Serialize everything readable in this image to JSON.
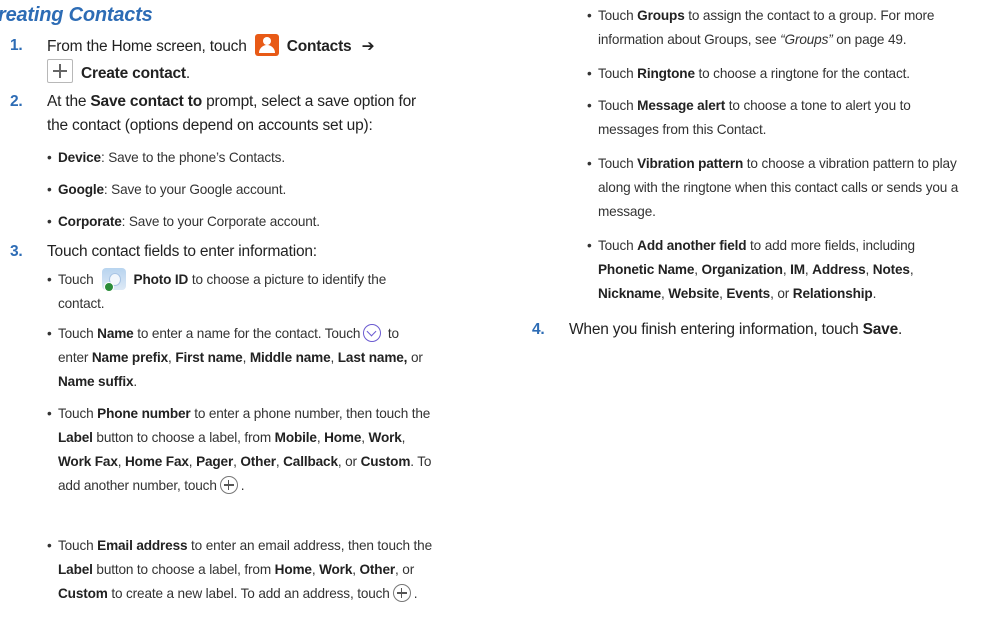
{
  "heading": "reating Contacts",
  "arrow": "➔",
  "step1": {
    "num": "1.",
    "t1": "From the Home screen, touch",
    "contacts": "Contacts",
    "create": "Create contact",
    "end": "."
  },
  "step2": {
    "num": "2.",
    "t1": "At the",
    "save_to": "Save contact to",
    "t2": "prompt, select a save option for",
    "t3": "the contact (options depend on accounts set up):"
  },
  "save_options": [
    {
      "label": "Device",
      "text": ": Save to the phone’s Contacts."
    },
    {
      "label": "Google",
      "text": ": Save to your Google account."
    },
    {
      "label": "Corporate",
      "text": ": Save to your Corporate account."
    }
  ],
  "step3": {
    "num": "3.",
    "text": "Touch contact fields to enter information:"
  },
  "photo": {
    "touch": "Touch",
    "label": "Photo ID",
    "t1": "to choose a picture to identify the",
    "t2": "contact."
  },
  "name": {
    "touch": "Touch",
    "label": "Name",
    "t1": "to enter a name for the contact. Touch",
    "t2": "to",
    "enter": "enter",
    "f1": "Name prefix",
    "f2": "First name",
    "f3": "Middle name",
    "f4": "Last name,",
    "or": "or",
    "f5": "Name suffix",
    "end": "."
  },
  "phone": {
    "touch": "Touch",
    "label": "Phone number",
    "t1": "to enter a phone number, then touch the",
    "btn": "Label",
    "t2": "button to choose a label, from",
    "l1": "Mobile",
    "l2": "Home",
    "l3": "Work",
    "l4": "Work Fax",
    "l5": "Home Fax",
    "l6": "Pager",
    "l7": "Other",
    "l8": "Callback",
    "or": "or",
    "l9": "Custom",
    "t3": ". To",
    "t4": "add another number, touch",
    "end": "."
  },
  "email": {
    "touch": "Touch",
    "label": "Email address",
    "t1": "to enter an email address, then touch the",
    "btn": "Label",
    "t2": "button to choose a label, from",
    "l1": "Home",
    "l2": "Work",
    "l3": "Other",
    "or": "or",
    "l4": "Custom",
    "t3": "to create a new label. To add an address, touch",
    "end": "."
  },
  "groups": {
    "touch": "Touch",
    "label": "Groups",
    "t1": "to assign the contact to a group. For more",
    "t2": "information about Groups, see",
    "ref": "“Groups”",
    "t3": "on page 49."
  },
  "ringtone": {
    "touch": "Touch",
    "label": "Ringtone",
    "text": "to choose a ringtone for the contact."
  },
  "alert": {
    "touch": "Touch",
    "label": "Message alert",
    "t1": "to choose a tone to alert you to",
    "t2": "messages from this Contact."
  },
  "vibration": {
    "touch": "Touch",
    "label": "Vibration pattern",
    "t1": "to choose a vibration pattern to play",
    "t2": "along with the ringtone when this contact calls or sends you a",
    "t3": "message."
  },
  "another": {
    "touch": "Touch",
    "label": "Add another field",
    "t1": "to add more fields, including",
    "f1": "Phonetic Name",
    "f2": "Organization",
    "f3": "IM",
    "f4": "Address",
    "f5": "Notes",
    "f6": "Nickname",
    "f7": "Website",
    "f8": "Events",
    "or": "or",
    "f9": "Relationship",
    "end": "."
  },
  "step4": {
    "num": "4.",
    "text": "When you finish entering information, touch",
    "save": "Save",
    "end": "."
  },
  "icons": {
    "contacts": "contacts-app-icon",
    "plus": "plus-box-icon",
    "photo": "photo-id-icon",
    "expand": "chevron-down-circle-icon",
    "add": "plus-circle-icon"
  },
  "colors": {
    "heading": "#2d6cb5",
    "step_number": "#2d6cb5",
    "contacts_icon": "#e85a16"
  }
}
